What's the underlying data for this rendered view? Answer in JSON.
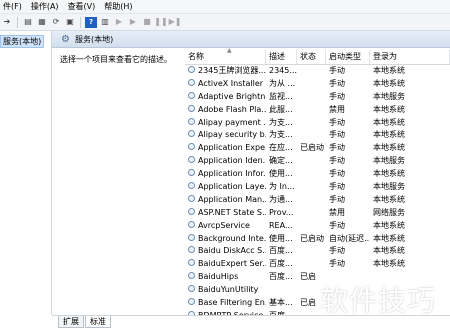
{
  "menu": [
    "件(F)",
    "操作(A)",
    "查看(V)",
    "帮助(H)"
  ],
  "tree": {
    "selected": "服务(本地)"
  },
  "banner": {
    "title": "服务(本地)"
  },
  "description_hint": "选择一个项目来查看它的描述。",
  "table": {
    "headers": [
      "名称",
      "描述",
      "状态",
      "启动类型",
      "登录为"
    ],
    "rows": [
      [
        "2345王牌浏览器...",
        "2345...",
        "",
        "手动",
        "本地系统"
      ],
      [
        "ActiveX Installer ...",
        "为从 ...",
        "",
        "手动",
        "本地系统"
      ],
      [
        "Adaptive Brightn...",
        "监视...",
        "",
        "手动",
        "本地服务"
      ],
      [
        "Adobe Flash Pla...",
        "此服...",
        "",
        "禁用",
        "本地系统"
      ],
      [
        "Alipay payment ...",
        "为支...",
        "",
        "手动",
        "本地系统"
      ],
      [
        "Alipay security b...",
        "为支...",
        "",
        "手动",
        "本地系统"
      ],
      [
        "Application Expe...",
        "在应...",
        "已启动",
        "手动",
        "本地系统"
      ],
      [
        "Application Iden...",
        "确定...",
        "",
        "手动",
        "本地服务"
      ],
      [
        "Application Infor...",
        "使用...",
        "",
        "手动",
        "本地系统"
      ],
      [
        "Application Laye...",
        "为 In...",
        "",
        "手动",
        "本地服务"
      ],
      [
        "Application Man...",
        "为通...",
        "",
        "手动",
        "本地系统"
      ],
      [
        "ASP.NET State S...",
        "Prov...",
        "",
        "禁用",
        "网络服务"
      ],
      [
        "AvrcpService",
        "REA...",
        "",
        "手动",
        "本地系统"
      ],
      [
        "Background Inte...",
        "使用...",
        "已启动",
        "自动(延迟...",
        "本地系统"
      ],
      [
        "Baidu DiskAcc S...",
        "百度...",
        "",
        "手动",
        "本地系统"
      ],
      [
        "BaiduExpert Ser...",
        "百度...",
        "",
        "手动",
        "本地系统"
      ],
      [
        "BaiduHips",
        "百度...",
        "已启",
        "",
        ""
      ],
      [
        "BaiduYunUtility",
        "",
        "",
        "",
        ""
      ],
      [
        "Base Filtering En...",
        "基本...",
        "已启",
        "",
        ""
      ],
      [
        "BDMRTP Service",
        "百度...",
        "",
        "",
        ""
      ]
    ]
  },
  "tabs": [
    "扩展",
    "标准"
  ],
  "watermark": "软件技巧"
}
